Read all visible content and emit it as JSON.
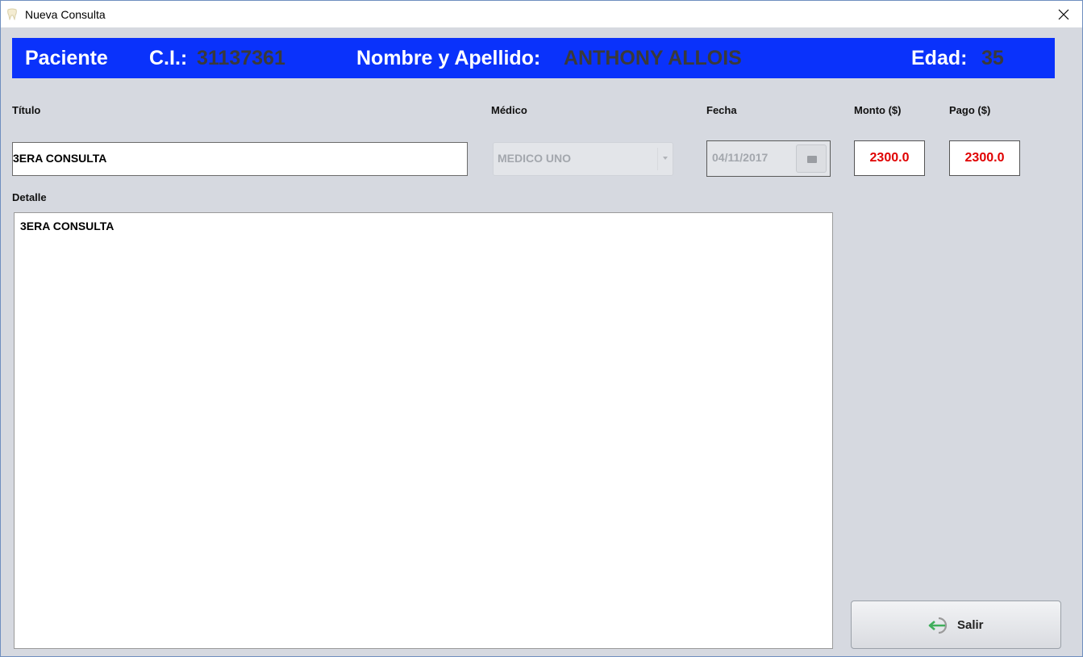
{
  "window": {
    "title": "Nueva Consulta",
    "app_icon": "tooth-icon",
    "close_icon": "close-icon"
  },
  "patient_banner": {
    "section_label": "Paciente",
    "ci_label": "C.I.:",
    "ci_value": "31137361",
    "name_label": "Nombre y Apellido:",
    "name_value": "ANTHONY ALLOIS",
    "age_label": "Edad:",
    "age_value": "35",
    "background_color": "#0a32fb"
  },
  "form": {
    "titulo_label": "Título",
    "titulo_value": "3ERA CONSULTA",
    "medico_label": "Médico",
    "medico_value": "MEDICO UNO",
    "fecha_label": "Fecha",
    "fecha_value": "04/11/2017",
    "monto_label": "Monto ($)",
    "monto_value": "2300.0",
    "pago_label": "Pago ($)",
    "pago_value": "2300.0",
    "detalle_label": "Detalle",
    "detalle_value": "3ERA CONSULTA",
    "amount_color": "#e00000"
  },
  "actions": {
    "salir_label": "Salir",
    "salir_icon": "exit-arrow-icon"
  }
}
